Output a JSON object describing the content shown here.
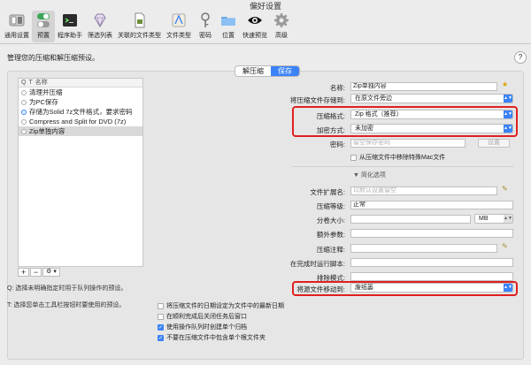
{
  "window": {
    "title": "偏好设置"
  },
  "toolbar": [
    {
      "label": "通用设置",
      "icon": "general-switch-icon"
    },
    {
      "label": "预置",
      "icon": "presets-toggle-icon"
    },
    {
      "label": "程序助手",
      "icon": "terminal-icon"
    },
    {
      "label": "筛选列表",
      "icon": "gem-icon"
    },
    {
      "label": "关联的文件类型",
      "icon": "document-icon"
    },
    {
      "label": "文件类型",
      "icon": "app-icon"
    },
    {
      "label": "密码",
      "icon": "key-icon"
    },
    {
      "label": "位置",
      "icon": "folder-icon"
    },
    {
      "label": "快速预览",
      "icon": "eye-icon"
    },
    {
      "label": "高级",
      "icon": "gear-icon"
    }
  ],
  "subtitle": "管理您的压缩和解压缩预设。",
  "help": "?",
  "tabs": [
    "解压缩",
    "保存"
  ],
  "preset_list": {
    "headers": [
      "Q",
      "T",
      "名称"
    ],
    "rows": [
      {
        "name": "清理并压缩",
        "radio": false
      },
      {
        "name": "为PC保存",
        "radio": false
      },
      {
        "name": "存储为Solid 7z文件格式，要求密码",
        "radio": true
      },
      {
        "name": "Compress and Split for DVD (7z)",
        "radio": false
      },
      {
        "name": "Zip单独内容",
        "radio": false,
        "selected": true
      }
    ],
    "buttons": [
      "+",
      "−",
      "⚙ ▾"
    ]
  },
  "notes": {
    "q": "Q: 选择未明确指定时用于队列操作的预设。",
    "t": "T: 选择您单击工具栏按钮时要使用的预设。"
  },
  "form": {
    "name_label": "名称:",
    "name_value": "Zip单独内容",
    "save_loc_label": "将压缩文件存储到:",
    "save_loc_value": "在原文件旁边",
    "format_label": "压缩格式:",
    "format_value": "Zip 格式（推荐）",
    "encrypt_label": "加密方式:",
    "encrypt_value": "未加密",
    "password_label": "密码:",
    "password_placeholder": "留空保存密码",
    "set_button": "设置",
    "exclude_mac": "从压缩文件中移除特殊Mac文件",
    "simplify": "简化选项",
    "ext_label": "文件扩展名:",
    "ext_placeholder": "以默认设置留空",
    "level_label": "压缩等级:",
    "level_value": "正常",
    "split_label": "分卷大小:",
    "split_unit": "MB",
    "extra_label": "额外参数:",
    "comment_label": "压缩注释:",
    "script_label": "在完成时运行脚本:",
    "exclude_label": "排除模式:",
    "move_label": "将源文件移动到:",
    "move_value": "废纸篓"
  },
  "checkboxes": [
    {
      "label": "将压缩文件的日期设定为文件中的最新日期",
      "checked": false
    },
    {
      "label": "在顺利完成后关闭任务后窗口",
      "checked": false
    },
    {
      "label": "使用操作队列时创建单个归档",
      "checked": true
    },
    {
      "label": "不要在压缩文件中包含单个根文件夹",
      "checked": true
    }
  ],
  "colors": {
    "accent": "#3b82f6",
    "highlight": "#e02020"
  }
}
